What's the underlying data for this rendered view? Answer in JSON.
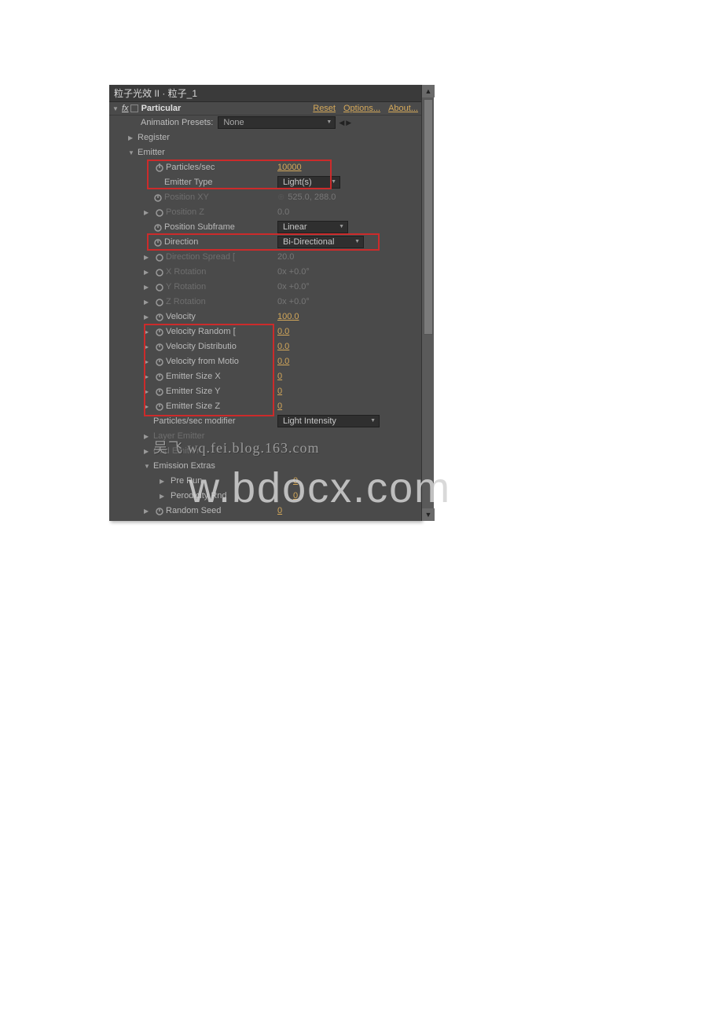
{
  "title_bar": "粒子光效 II · 粒子_1",
  "fx": {
    "name": "Particular",
    "reset": "Reset",
    "options": "Options...",
    "about": "About..."
  },
  "presets": {
    "label": "Animation Presets:",
    "value": "None"
  },
  "register": {
    "label": "Register"
  },
  "emitter": {
    "label": "Emitter",
    "items": {
      "particles_sec": {
        "label": "Particles/sec",
        "value": "10000"
      },
      "emitter_type": {
        "label": "Emitter Type",
        "value": "Light(s)"
      },
      "position_xy": {
        "label": "Position XY",
        "value": "525.0, 288.0"
      },
      "position_z": {
        "label": "Position Z",
        "value": "0.0"
      },
      "position_subframe": {
        "label": "Position Subframe",
        "value": "Linear"
      },
      "direction": {
        "label": "Direction",
        "value": "Bi-Directional"
      },
      "direction_spread": {
        "label": "Direction Spread [",
        "value": "20.0"
      },
      "x_rotation": {
        "label": "X Rotation",
        "value": "0x +0.0°"
      },
      "y_rotation": {
        "label": "Y Rotation",
        "value": "0x +0.0°"
      },
      "z_rotation": {
        "label": "Z Rotation",
        "value": "0x +0.0°"
      },
      "velocity": {
        "label": "Velocity",
        "value": "100.0"
      },
      "velocity_random": {
        "label": "Velocity Random [",
        "value": "0.0"
      },
      "velocity_distrib": {
        "label": "Velocity Distributio",
        "value": "0.0"
      },
      "velocity_motion": {
        "label": "Velocity from Motio",
        "value": "0.0"
      },
      "emitter_size_x": {
        "label": "Emitter Size X",
        "value": "0"
      },
      "emitter_size_y": {
        "label": "Emitter Size Y",
        "value": "0"
      },
      "emitter_size_z": {
        "label": "Emitter Size Z",
        "value": "0"
      },
      "modifier": {
        "label": "Particles/sec modifier",
        "value": "Light Intensity"
      },
      "layer_emitter": {
        "label": "Layer Emitter"
      },
      "grid_emitter": {
        "label": "Grid Emitter"
      }
    },
    "extras": {
      "label": "Emission Extras",
      "pre_run": {
        "label": "Pre Run",
        "value": "0"
      },
      "period_rnd": {
        "label": "Perodicity Rnd",
        "value": "0"
      },
      "random_seed": {
        "label": "Random Seed",
        "value": "0"
      }
    }
  },
  "watermark_small": "吴飞 wq.fei.blog.163.com",
  "watermark_big": "w.bdocx.com"
}
